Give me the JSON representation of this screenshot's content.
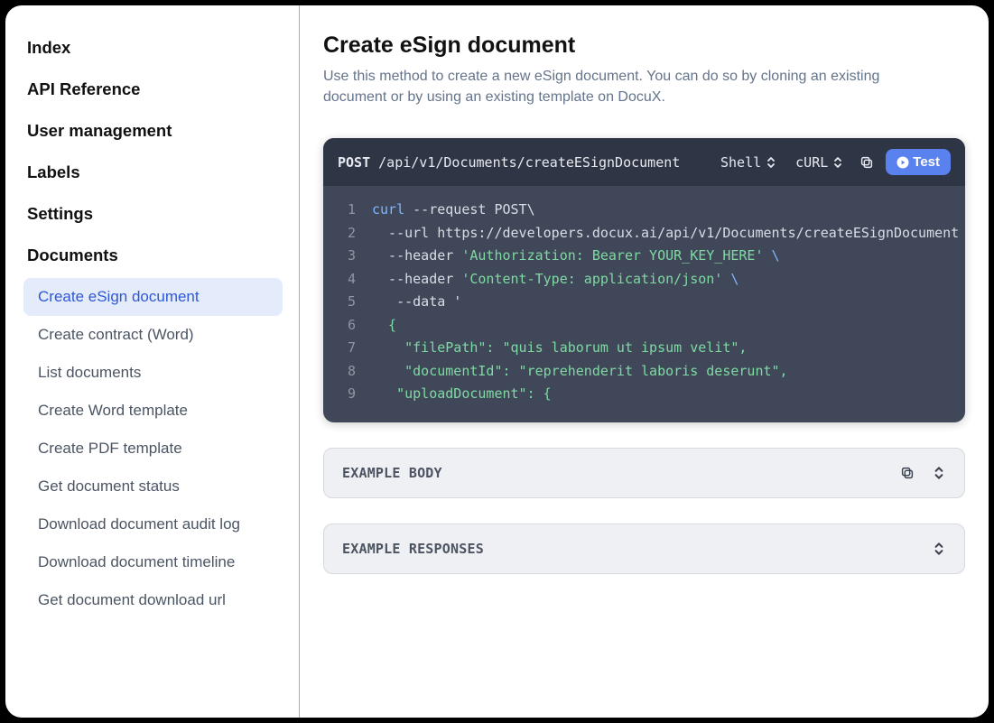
{
  "sidebar": {
    "sections": [
      {
        "label": "Index"
      },
      {
        "label": "API Reference"
      },
      {
        "label": "User management"
      },
      {
        "label": "Labels"
      },
      {
        "label": "Settings"
      },
      {
        "label": "Documents",
        "expanded": true
      }
    ],
    "documents_items": [
      {
        "label": "Create eSign document",
        "active": true
      },
      {
        "label": "Create contract (Word)"
      },
      {
        "label": "List documents"
      },
      {
        "label": "Create Word template"
      },
      {
        "label": "Create PDF template"
      },
      {
        "label": "Get document status"
      },
      {
        "label": "Download document audit log"
      },
      {
        "label": "Download document timeline"
      },
      {
        "label": "Get document download url"
      }
    ]
  },
  "main": {
    "title": "Create eSign document",
    "description": "Use this method to create a new eSign document. You can do so by cloning an existing document or by using an existing template on DocuX."
  },
  "code": {
    "method": "POST",
    "path": "/api/v1/Documents/createESignDocument",
    "language_selector": "Shell",
    "client_selector": "cURL",
    "test_label": "Test",
    "lines": {
      "l1_kw": "curl",
      "l1_rest": " --request POST\\",
      "l2_text": "  --url https://developers.docux.ai/api/v1/Documents/createESignDocument ",
      "l2_cont": "\\",
      "l3_pre": "  --header ",
      "l3_str": "'Authorization: Bearer YOUR_KEY_HERE'",
      "l3_cont": " \\",
      "l4_pre": "  --header ",
      "l4_str": "'Content-Type: application/json'",
      "l4_cont": " \\",
      "l5_text": "   --data '",
      "l6_text": "  {",
      "l6_color": "str",
      "l7_text": "    \"filePath\": \"quis laborum ut ipsum velit\",",
      "l8_text": "    \"documentId\": \"reprehenderit laboris deserunt\",",
      "l9_text": "   \"uploadDocument\": {"
    },
    "line_numbers": [
      "1",
      "2",
      "3",
      "4",
      "5",
      "6",
      "7",
      "8",
      "9"
    ]
  },
  "panels": {
    "body_title": "EXAMPLE BODY",
    "responses_title": "EXAMPLE RESPONSES"
  }
}
